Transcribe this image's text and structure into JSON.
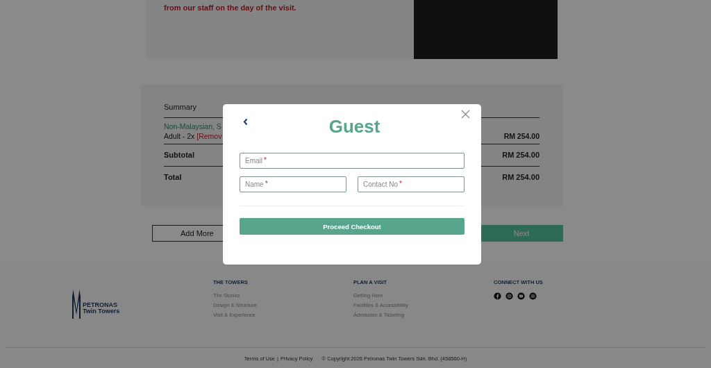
{
  "notice": {
    "text": "from our staff on the day of the visit."
  },
  "summary": {
    "title": "Summary",
    "item": {
      "name": "Non-Malaysian, S",
      "line": "Adult - 2x",
      "remove": "[Remov",
      "price": "RM 254.00"
    },
    "rows": [
      {
        "label": "Subtotal",
        "value": "RM 254.00"
      },
      {
        "label": "Total",
        "value": "RM 254.00"
      }
    ]
  },
  "actions": {
    "add_more": "Add More",
    "next": "Next"
  },
  "footer": {
    "logo": {
      "line1": "PETRONAS",
      "line2": "Twin Towers"
    },
    "columns": [
      {
        "heading": "THE TOWERS",
        "links": [
          "The Stories",
          "Design & Structure",
          "Visit & Experience"
        ]
      },
      {
        "heading": "PLAN A VISIT",
        "links": [
          "Getting Here",
          "Facilities & Accessibility",
          "Admission & Ticketing"
        ]
      }
    ],
    "connect": {
      "heading": "CONNECT WITH US"
    },
    "legal": {
      "links": [
        "Terms of Use",
        "Privacy Policy"
      ],
      "separator": "|",
      "copyright": "© Copyright 2026 Petronas Twin Towers Sdn. Bhd. (458560-H)"
    }
  },
  "modal": {
    "title": "Guest",
    "fields": [
      {
        "placeholder": "Email",
        "required_mark": "*",
        "kind": "wide"
      },
      {
        "placeholder": "Name",
        "required_mark": "*",
        "kind": "half"
      },
      {
        "placeholder": "Contact No",
        "required_mark": "*",
        "kind": "half"
      }
    ],
    "submit": "Proceed Checkout"
  }
}
